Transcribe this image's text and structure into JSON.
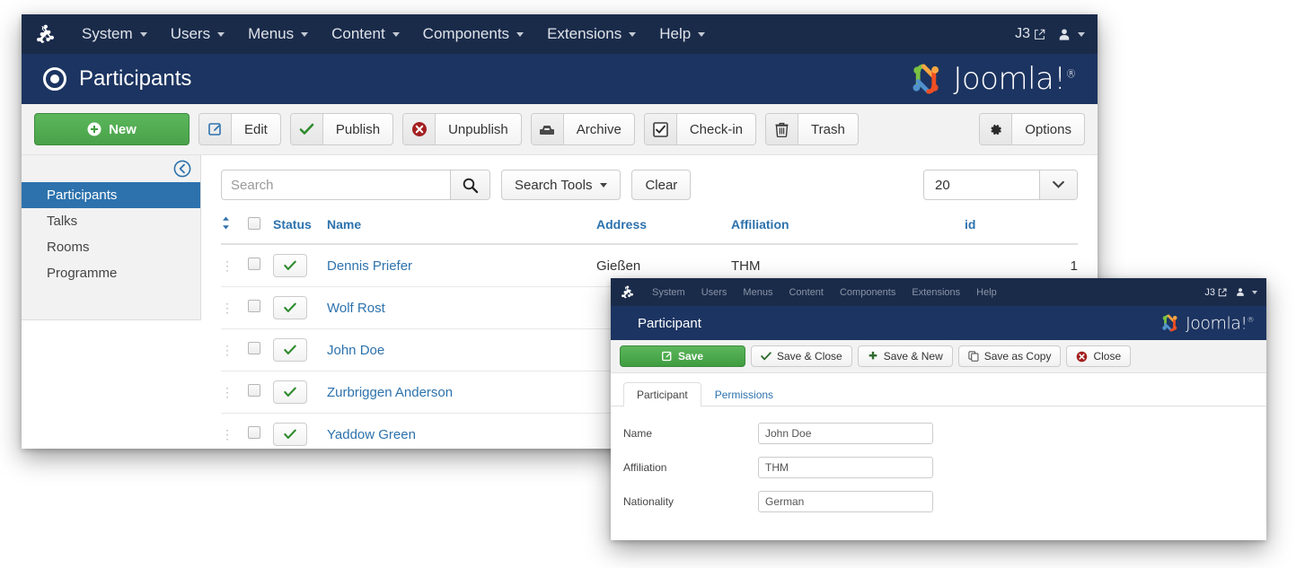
{
  "main_window": {
    "navbar": {
      "logo_icon": "joomla-logo-icon",
      "items": [
        {
          "label": "System",
          "caret": true
        },
        {
          "label": "Users",
          "caret": true
        },
        {
          "label": "Menus",
          "caret": true
        },
        {
          "label": "Content",
          "caret": true
        },
        {
          "label": "Components",
          "caret": true
        },
        {
          "label": "Extensions",
          "caret": true
        },
        {
          "label": "Help",
          "caret": true
        }
      ],
      "site_label": "J3",
      "site_icon": "external-link-icon",
      "user_icon": "user-icon"
    },
    "subhead": {
      "title": "Participants",
      "title_icon": "radio-target-icon",
      "brand": "Joomla!",
      "brand_sup": "®"
    },
    "toolbar": {
      "new_label": "New",
      "new_icon": "plus-circle-icon",
      "buttons": [
        {
          "label": "Edit",
          "icon": "pencil-square-icon"
        },
        {
          "label": "Publish",
          "icon": "check-icon"
        },
        {
          "label": "Unpublish",
          "icon": "times-circle-icon"
        },
        {
          "label": "Archive",
          "icon": "archive-box-icon"
        },
        {
          "label": "Check-in",
          "icon": "checkbox-icon"
        },
        {
          "label": "Trash",
          "icon": "trash-icon"
        }
      ],
      "options_label": "Options",
      "options_icon": "gear-icon"
    },
    "sidebar": {
      "collapse_icon": "arrow-left-circle-icon",
      "items": [
        {
          "label": "Participants",
          "active": true
        },
        {
          "label": "Talks",
          "active": false
        },
        {
          "label": "Rooms",
          "active": false
        },
        {
          "label": "Programme",
          "active": false
        }
      ]
    },
    "search": {
      "placeholder": "Search",
      "value": "",
      "search_icon": "magnifier-icon",
      "search_tools_label": "Search Tools",
      "clear_label": "Clear",
      "limit_value": "20",
      "limit_icon": "chevron-down-icon"
    },
    "table": {
      "headers": {
        "ordering": "ordering-sort-icon",
        "checkall": "",
        "status": "Status",
        "name": "Name",
        "address": "Address",
        "affiliation": "Affiliation",
        "id": "id"
      },
      "rows": [
        {
          "name": "Dennis Priefer",
          "address": "Gießen",
          "affiliation": "THM",
          "id": "1",
          "status": "published"
        },
        {
          "name": "Wolf Rost",
          "address": "",
          "affiliation": "",
          "id": "",
          "status": "published"
        },
        {
          "name": "John Doe",
          "address": "",
          "affiliation": "",
          "id": "",
          "status": "published"
        },
        {
          "name": "Zurbriggen Anderson",
          "address": "",
          "affiliation": "",
          "id": "",
          "status": "published"
        },
        {
          "name": "Yaddow Green",
          "address": "",
          "affiliation": "",
          "id": "",
          "status": "published"
        }
      ]
    }
  },
  "modal_window": {
    "navbar": {
      "logo_icon": "joomla-logo-icon",
      "items": [
        {
          "label": "System"
        },
        {
          "label": "Users"
        },
        {
          "label": "Menus"
        },
        {
          "label": "Content"
        },
        {
          "label": "Components"
        },
        {
          "label": "Extensions"
        },
        {
          "label": "Help"
        }
      ],
      "site_label": "J3",
      "site_icon": "external-link-icon",
      "user_icon": "user-icon"
    },
    "subhead": {
      "title": "Participant",
      "brand": "Joomla!",
      "brand_sup": "®"
    },
    "toolbar": {
      "save_label": "Save",
      "save_icon": "pencil-square-icon",
      "buttons": [
        {
          "label": "Save & Close",
          "icon": "check-icon"
        },
        {
          "label": "Save & New",
          "icon": "plus-icon"
        },
        {
          "label": "Save as Copy",
          "icon": "copy-icon"
        },
        {
          "label": "Close",
          "icon": "times-circle-icon"
        }
      ]
    },
    "tabs": [
      {
        "label": "Participant",
        "active": true
      },
      {
        "label": "Permissions",
        "active": false
      }
    ],
    "form": [
      {
        "label": "Name",
        "value": "John Doe"
      },
      {
        "label": "Affiliation",
        "value": "THM"
      },
      {
        "label": "Nationality",
        "value": "German"
      }
    ]
  },
  "colors": {
    "navbar_bg": "#1a2b4a",
    "subhead_bg": "#1c3461",
    "accent_blue": "#2d72ad",
    "success_green": "#49a249",
    "danger_red": "#a32020",
    "sidebar_bg": "#f2f2f2"
  }
}
